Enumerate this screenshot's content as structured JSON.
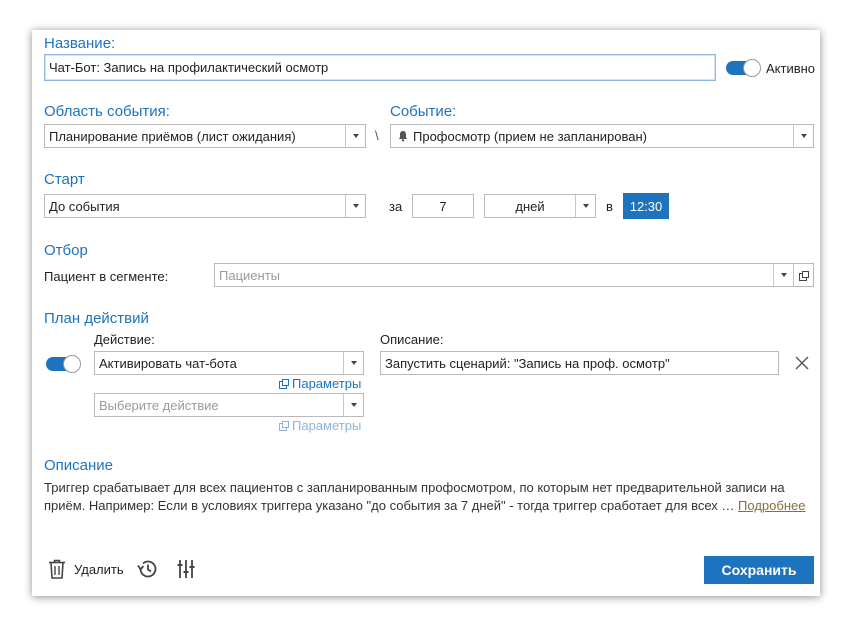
{
  "name": {
    "label": "Название:",
    "value": "Чат-Бот: Запись на профилактический осмотр",
    "active_label": "Активно"
  },
  "event_area": {
    "label": "Область события:",
    "value": "Планирование приёмов (лист ожидания)",
    "separator": "\\"
  },
  "event": {
    "label": "Событие:",
    "value": "Профосмотр (прием не запланирован)"
  },
  "start": {
    "label": "Старт",
    "value": "До события",
    "za_label": "за",
    "amount": "7",
    "unit": "дней",
    "v_label": "в",
    "time": "12:30"
  },
  "filter": {
    "label": "Отбор",
    "segment_label": "Пациент в сегменте:",
    "segment_placeholder": "Пациенты"
  },
  "plan": {
    "label": "План действий",
    "action_label": "Действие:",
    "description_label": "Описание:",
    "action1_value": "Активировать чат-бота",
    "action1_params": "Параметры",
    "action1_description": "Запустить сценарий: \"Запись на проф. осмотр\"",
    "action2_placeholder": "Выберите действие",
    "action2_params": "Параметры"
  },
  "description": {
    "label": "Описание",
    "line1": "Триггер срабатывает для всех пациентов с запланированным профосмотром, по которым нет предварительной записи на",
    "line2": "приём. Например: Если в условиях триггера указано \"до события за 7 дней\" - тогда триггер сработает для всех …",
    "more_link": "Подробнее"
  },
  "footer": {
    "delete_label": "Удалить",
    "save_label": "Сохранить"
  },
  "colors": {
    "accent": "#1e73be",
    "more_link": "#8a6d3b"
  }
}
